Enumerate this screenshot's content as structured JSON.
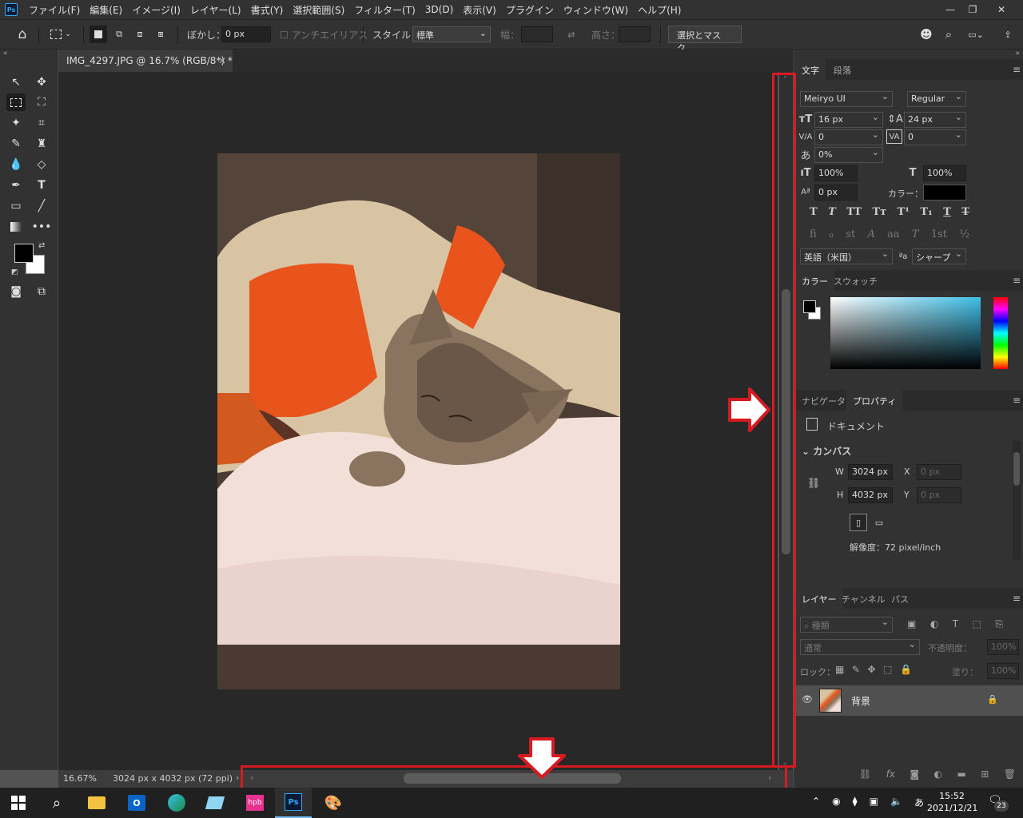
{
  "menubar": {
    "logo": "Ps",
    "items": [
      "ファイル(F)",
      "編集(E)",
      "イメージ(I)",
      "レイヤー(L)",
      "書式(Y)",
      "選択範囲(S)",
      "フィルター(T)",
      "3D(D)",
      "表示(V)",
      "プラグイン",
      "ウィンドウ(W)",
      "ヘルプ(H)"
    ]
  },
  "options": {
    "feather_label": "ぼかし：",
    "feather_value": "0 px",
    "antialias_label": "アンチエイリアス",
    "style_label": "スタイル：",
    "style_value": "標準",
    "width_label": "幅：",
    "height_label": "高さ：",
    "select_mask_label": "選択とマスク..."
  },
  "document": {
    "tab_title": "IMG_4297.JPG @ 16.7% (RGB/8*) *",
    "zoom": "16.67%",
    "dimensions": "3024 px x 4032 px (72 ppi)"
  },
  "character": {
    "tabs": [
      "文字",
      "段落"
    ],
    "font_family": "Meiryo UI",
    "font_style": "Regular",
    "size": "16 px",
    "leading": "24 px",
    "kerning": "0",
    "tracking": "0",
    "tsume": "0%",
    "vscale": "100%",
    "hscale": "100%",
    "baseline": "0 px",
    "color_label": "カラー：",
    "color_value": "#000000",
    "language": "英語（米国）",
    "aa_icon_text": "ªa",
    "antialias": "シャープ",
    "style_buttons": [
      "T",
      "T",
      "TT",
      "Tт",
      "T¹",
      "T₁",
      "T",
      "T"
    ],
    "ot_buttons": [
      "fi",
      "ℴ",
      "st",
      "A",
      "aa",
      "T",
      "1st",
      "½"
    ]
  },
  "color_panel": {
    "tabs": [
      "カラー",
      "スウォッチ"
    ],
    "foreground": "#000000",
    "background": "#ffffff",
    "hue_color": "#3fbfe8"
  },
  "properties": {
    "tabs": [
      "ナビゲーター",
      "プロパティ"
    ],
    "doc_label": "ドキュメント",
    "canvas_label": "カンバス",
    "w_label": "W",
    "w_value": "3024 px",
    "h_label": "H",
    "h_value": "4032 px",
    "x_label": "X",
    "x_placeholder": "0 px",
    "y_label": "Y",
    "y_placeholder": "0 px",
    "resolution": "解像度：72 pixel/inch"
  },
  "layers": {
    "tabs": [
      "レイヤー",
      "チャンネル",
      "パス"
    ],
    "filter_placeholder": "種類",
    "blend_mode": "通常",
    "opacity_label": "不透明度：",
    "opacity_value": "100%",
    "lock_label": "ロック：",
    "fill_label": "塗り：",
    "fill_value": "100%",
    "layer_name": "背景",
    "bottom_icons": [
      "link-icon",
      "fx-icon",
      "mask-icon",
      "adjustment-icon",
      "folder-icon",
      "new-layer-icon",
      "trash-icon"
    ]
  },
  "taskbar": {
    "time": "15:52",
    "date": "2021/12/21",
    "ime": "あ",
    "notifications": "23"
  },
  "accent": "#d71920"
}
